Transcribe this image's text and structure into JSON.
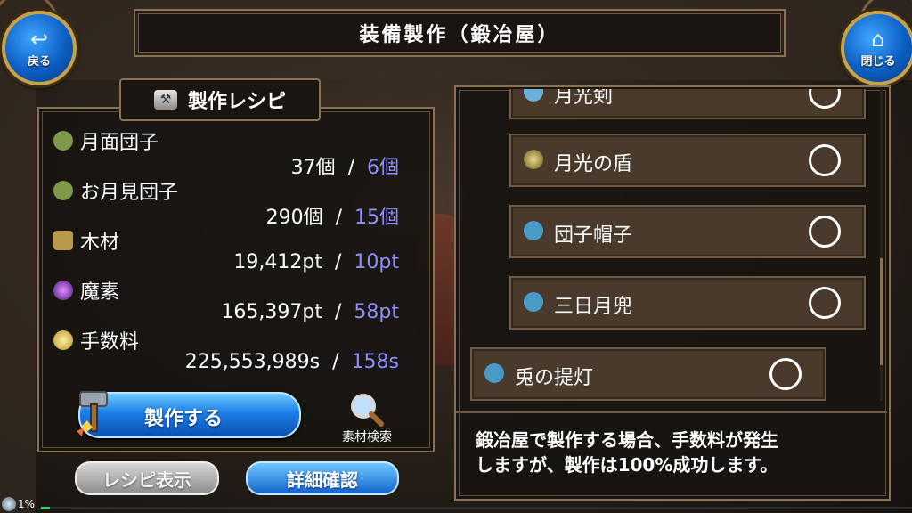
{
  "header": {
    "title": "装備製作（鍛冶屋）"
  },
  "nav": {
    "back_label": "戻る",
    "back_icon": "back-arrow-icon",
    "close_label": "閉じる",
    "close_icon": "home-icon"
  },
  "recipe_panel": {
    "title": "製作レシピ",
    "materials": [
      {
        "name": "月面団子",
        "icon": "pouch-icon",
        "have": "37個",
        "sep": "/",
        "need": "6個"
      },
      {
        "name": "お月見団子",
        "icon": "pouch-icon",
        "have": "290個",
        "sep": "/",
        "need": "15個"
      },
      {
        "name": "木材",
        "icon": "wood-icon",
        "have": "19,412pt",
        "sep": "/",
        "need": "10pt"
      },
      {
        "name": "魔素",
        "icon": "orb-icon",
        "have": "165,397pt",
        "sep": "/",
        "need": "58pt"
      },
      {
        "name": "手数料",
        "icon": "coins-icon",
        "have": "225,553,989s",
        "sep": "/",
        "need": "158s"
      }
    ],
    "craft_label": "製作する",
    "search_label": "素材検索"
  },
  "bottom_buttons": {
    "recipe_label": "レシピ表示",
    "detail_label": "詳細確認"
  },
  "item_list": {
    "items": [
      {
        "name": "月光剣",
        "icon": "sword-icon",
        "selected": false
      },
      {
        "name": "月光の盾",
        "icon": "shield-icon",
        "selected": false
      },
      {
        "name": "団子帽子",
        "icon": "hat-icon",
        "selected": false
      },
      {
        "name": "三日月兜",
        "icon": "helmet-icon",
        "selected": false
      },
      {
        "name": "兎の提灯",
        "icon": "lantern-icon",
        "selected": false
      }
    ]
  },
  "description": {
    "line1": "鍛冶屋で製作する場合、手数料が発生",
    "line2": "しますが、製作は100%成功します。"
  },
  "status": {
    "progress_label": "1%",
    "progress_fraction": 0.01
  },
  "colors": {
    "required": "#8f8fff",
    "accent_blue": "#1d7ee8",
    "frame_gold": "#8a7354"
  }
}
